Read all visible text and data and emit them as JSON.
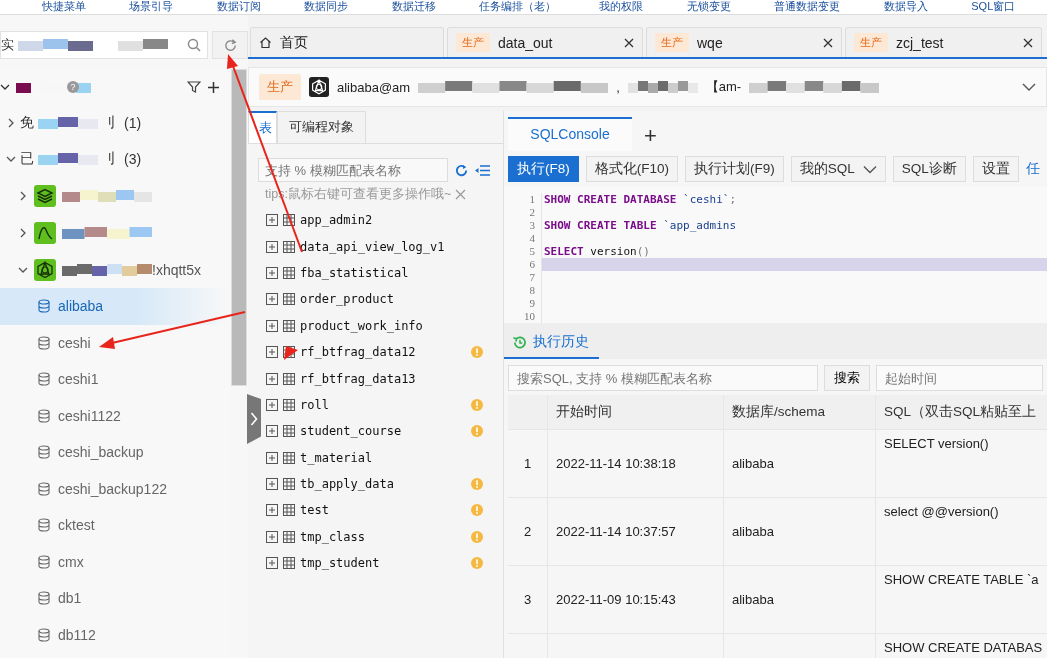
{
  "top_menu": [
    "快捷菜单",
    "场景引导",
    "数据订阅",
    "数据同步",
    "数据迁移",
    "任务编排（老）",
    "我的权限",
    "无锁变更",
    "普通数据变更",
    "数据导入",
    "SQL窗口"
  ],
  "sidebar": {
    "search_value": "实",
    "header_help": "?",
    "groups": [
      {
        "prefix": "免",
        "suffix": "刂",
        "count": "(1)",
        "expanded": false
      },
      {
        "prefix": "已",
        "suffix": "刂",
        "count": "(3)",
        "expanded": true,
        "children": [
          {
            "kind": "layers",
            "expanded": false
          },
          {
            "kind": "curve",
            "expanded": false
          },
          {
            "kind": "network",
            "suffix": "!xhqtt5x",
            "expanded": true
          }
        ]
      }
    ],
    "databases": [
      {
        "name": "alibaba",
        "selected": true
      },
      {
        "name": "ceshi",
        "selected": false
      },
      {
        "name": "ceshi1",
        "selected": false
      },
      {
        "name": "ceshi1122",
        "selected": false
      },
      {
        "name": "ceshi_backup",
        "selected": false
      },
      {
        "name": "ceshi_backup122",
        "selected": false
      },
      {
        "name": "cktest",
        "selected": false
      },
      {
        "name": "cmx",
        "selected": false
      },
      {
        "name": "db1",
        "selected": false
      },
      {
        "name": "db112",
        "selected": false
      }
    ]
  },
  "tabs": [
    {
      "kind": "home",
      "label": "首页",
      "selected": false
    },
    {
      "kind": "console",
      "env": "生产",
      "label": "data_out",
      "selected": false
    },
    {
      "kind": "console",
      "env": "生产",
      "label": "wqe",
      "selected": false
    },
    {
      "kind": "console",
      "env": "生产",
      "label": "zcj_test",
      "selected": false
    }
  ],
  "connection": {
    "env": "生产",
    "user": "alibaba@am",
    "separator": ",",
    "instance": "【am-"
  },
  "object_panel": {
    "tabs": [
      {
        "label": "表",
        "selected": true
      },
      {
        "label": "可编程对象",
        "selected": false
      }
    ],
    "filter_placeholder": "支持 % 模糊匹配表名称",
    "tip": "tips:鼠标右键可查看更多操作哦~",
    "tables": [
      {
        "name": "app_admin2",
        "warning": false
      },
      {
        "name": "data_api_view_log_v1",
        "warning": false
      },
      {
        "name": "fba_statistical",
        "warning": false
      },
      {
        "name": "order_product",
        "warning": false
      },
      {
        "name": "product_work_info",
        "warning": false
      },
      {
        "name": "rf_btfrag_data12",
        "warning": true
      },
      {
        "name": "rf_btfrag_data13",
        "warning": false
      },
      {
        "name": "roll",
        "warning": true
      },
      {
        "name": "student_course",
        "warning": true
      },
      {
        "name": "t_material",
        "warning": false
      },
      {
        "name": "tb_apply_data",
        "warning": true
      },
      {
        "name": "test",
        "warning": true
      },
      {
        "name": "tmp_class",
        "warning": true
      },
      {
        "name": "tmp_student",
        "warning": true
      }
    ]
  },
  "console": {
    "tabs": [
      {
        "label": "SQLConsole",
        "selected": true
      }
    ],
    "add_tab": "+",
    "toolbar": [
      {
        "label": "执行(F8)",
        "kind": "primary"
      },
      {
        "label": "格式化(F10)",
        "kind": "default"
      },
      {
        "label": "执行计划(F9)",
        "kind": "default"
      },
      {
        "label": "我的SQL",
        "kind": "dropdown"
      },
      {
        "label": "SQL诊断",
        "kind": "default"
      },
      {
        "label": "设置",
        "kind": "default"
      },
      {
        "label": "任",
        "kind": "link"
      }
    ],
    "editor": [
      {
        "number": "1",
        "active": false,
        "tokens": [
          {
            "text": "SHOW CREATE DATABASE",
            "kind": "keyword"
          },
          {
            "text": " `ceshi`",
            "kind": "string"
          },
          {
            "text": ";",
            "kind": "punct"
          }
        ]
      },
      {
        "number": "2",
        "active": false
      },
      {
        "number": "3",
        "active": false,
        "tokens": [
          {
            "text": "SHOW CREATE TABLE",
            "kind": "keyword"
          },
          {
            "text": " `app_admins",
            "kind": "string"
          }
        ]
      },
      {
        "number": "4",
        "active": false
      },
      {
        "number": "5",
        "active": false,
        "tokens": [
          {
            "text": "SELECT",
            "kind": "keyword"
          },
          {
            "text": " version",
            "kind": "plain"
          },
          {
            "text": "()",
            "kind": "punct"
          }
        ]
      },
      {
        "number": "6",
        "active": true
      },
      {
        "number": "7",
        "active": false
      },
      {
        "number": "8",
        "active": false
      },
      {
        "number": "9",
        "active": false
      },
      {
        "number": "10",
        "active": false
      }
    ]
  },
  "history": {
    "title": "执行历史",
    "search_placeholder": "搜索SQL, 支持 % 模糊匹配表名称",
    "search_button": "搜索",
    "start_placeholder": "起始时间",
    "columns": [
      "开始时间",
      "数据库/schema",
      "SQL（双击SQL粘贴至上"
    ],
    "rows": [
      {
        "index": "1",
        "time": "2022-11-14 10:38:18",
        "schema": "alibaba",
        "sql": "SELECT version()"
      },
      {
        "index": "2",
        "time": "2022-11-14 10:37:57",
        "schema": "alibaba",
        "sql": "select @@version()"
      },
      {
        "index": "3",
        "time": "2022-11-09 10:15:43",
        "schema": "alibaba",
        "sql": "SHOW CREATE TABLE `a"
      },
      {
        "sql": "SHOW CREATE DATABAS"
      }
    ]
  }
}
